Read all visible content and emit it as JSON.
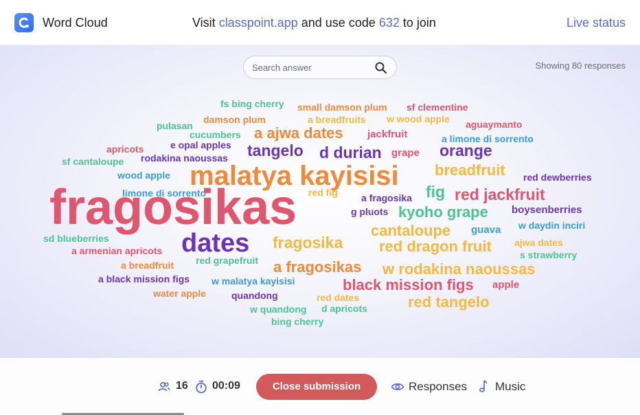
{
  "header": {
    "app_title": "Word Cloud",
    "join_prefix": "Visit ",
    "join_link": "classpoint.app",
    "join_middle": " and use code ",
    "join_code": "632",
    "join_suffix": " to join",
    "live_status": "Live status"
  },
  "search": {
    "placeholder": "Search answer"
  },
  "showing": "Showing 80 responses",
  "words": [
    {
      "text": "fs bing cherry",
      "color": "#4cc48f",
      "size": 14
    },
    {
      "text": "small damson plum",
      "color": "#f08a3a",
      "size": 14
    },
    {
      "text": "sf clementine",
      "color": "#e0566e",
      "size": 14
    },
    {
      "text": "damson plum",
      "color": "#f08a3a",
      "size": 14
    },
    {
      "text": "a breadfruits",
      "color": "#f4b93e",
      "size": 14
    },
    {
      "text": "w wood apple",
      "color": "#f4b93e",
      "size": 14
    },
    {
      "text": "aguaymanto",
      "color": "#e0566e",
      "size": 14
    },
    {
      "text": "pulasan",
      "color": "#4cc48f",
      "size": 14
    },
    {
      "text": "cucumbers",
      "color": "#4cc48f",
      "size": 14
    },
    {
      "text": "a ajwa dates",
      "color": "#f08a3a",
      "size": 22
    },
    {
      "text": "jackfruit",
      "color": "#e0566e",
      "size": 15
    },
    {
      "text": "a limone di sorrento",
      "color": "#3d9ad6",
      "size": 14
    },
    {
      "text": "apricots",
      "color": "#e0566e",
      "size": 14
    },
    {
      "text": "e opal apples",
      "color": "#6a33b8",
      "size": 14
    },
    {
      "text": "tangelo",
      "color": "#6a33b8",
      "size": 23
    },
    {
      "text": "d durian",
      "color": "#6a33b8",
      "size": 23
    },
    {
      "text": "grape",
      "color": "#e0566e",
      "size": 15
    },
    {
      "text": "orange",
      "color": "#6a33b8",
      "size": 23
    },
    {
      "text": "sf cantaloupe",
      "color": "#4cc48f",
      "size": 14
    },
    {
      "text": "rodakina naoussas",
      "color": "#6a33b8",
      "size": 14
    },
    {
      "text": "malatya kayisisi",
      "color": "#f08a3a",
      "size": 40
    },
    {
      "text": "breadfruit",
      "color": "#f4b93e",
      "size": 22
    },
    {
      "text": "wood apple",
      "color": "#3d9ad6",
      "size": 14
    },
    {
      "text": "red dewberries",
      "color": "#6a33b8",
      "size": 14
    },
    {
      "text": "limone di sorrento",
      "color": "#3d9ad6",
      "size": 14
    },
    {
      "text": "red fig",
      "color": "#f4b93e",
      "size": 14
    },
    {
      "text": "fig",
      "color": "#4cc48f",
      "size": 23
    },
    {
      "text": "red jackfruit",
      "color": "#e0566e",
      "size": 23
    },
    {
      "text": "fragosikas",
      "color": "#e0566e",
      "size": 72
    },
    {
      "text": "a fragosika",
      "color": "#6a33b8",
      "size": 14
    },
    {
      "text": "g pluots",
      "color": "#6a33b8",
      "size": 14
    },
    {
      "text": "kyoho grape",
      "color": "#4cc48f",
      "size": 22
    },
    {
      "text": "boysenberries",
      "color": "#6a33b8",
      "size": 15
    },
    {
      "text": "w daydin inciri",
      "color": "#3d9ad6",
      "size": 14
    },
    {
      "text": "cantaloupe",
      "color": "#f4b93e",
      "size": 22
    },
    {
      "text": "guava",
      "color": "#3d9ad6",
      "size": 15
    },
    {
      "text": "sd blueberries",
      "color": "#4cc48f",
      "size": 14
    },
    {
      "text": "dates",
      "color": "#6a33b8",
      "size": 38
    },
    {
      "text": "fragosika",
      "color": "#f4b93e",
      "size": 23
    },
    {
      "text": "red dragon fruit",
      "color": "#f4b93e",
      "size": 22
    },
    {
      "text": "ajwa dates",
      "color": "#f4b93e",
      "size": 14
    },
    {
      "text": "a armenian apricots",
      "color": "#e0566e",
      "size": 14
    },
    {
      "text": "s strawberry",
      "color": "#4cc48f",
      "size": 14
    },
    {
      "text": "red grapefruit",
      "color": "#4cc48f",
      "size": 14
    },
    {
      "text": "a breadfruit",
      "color": "#f08a3a",
      "size": 14
    },
    {
      "text": "a fragosikas",
      "color": "#f08a3a",
      "size": 22
    },
    {
      "text": "w rodakina naoussas",
      "color": "#f4b93e",
      "size": 22
    },
    {
      "text": "a black mission figs",
      "color": "#6a33b8",
      "size": 14
    },
    {
      "text": "w malatya kayisisi",
      "color": "#3d9ad6",
      "size": 14
    },
    {
      "text": "black mission figs",
      "color": "#e0566e",
      "size": 22
    },
    {
      "text": "apple",
      "color": "#e0566e",
      "size": 15
    },
    {
      "text": "water apple",
      "color": "#f08a3a",
      "size": 14
    },
    {
      "text": "quandong",
      "color": "#6a33b8",
      "size": 14
    },
    {
      "text": "red dates",
      "color": "#f4b93e",
      "size": 14
    },
    {
      "text": "red tangelo",
      "color": "#f4b93e",
      "size": 22
    },
    {
      "text": "w quandong",
      "color": "#4cc48f",
      "size": 14
    },
    {
      "text": "d apricots",
      "color": "#4cc48f",
      "size": 14
    },
    {
      "text": "bing cherry",
      "color": "#4cc48f",
      "size": 14
    }
  ],
  "footer": {
    "participants": "16",
    "timer": "00:09",
    "close_label": "Close submission",
    "responses_label": "Responses",
    "music_label": "Music"
  }
}
